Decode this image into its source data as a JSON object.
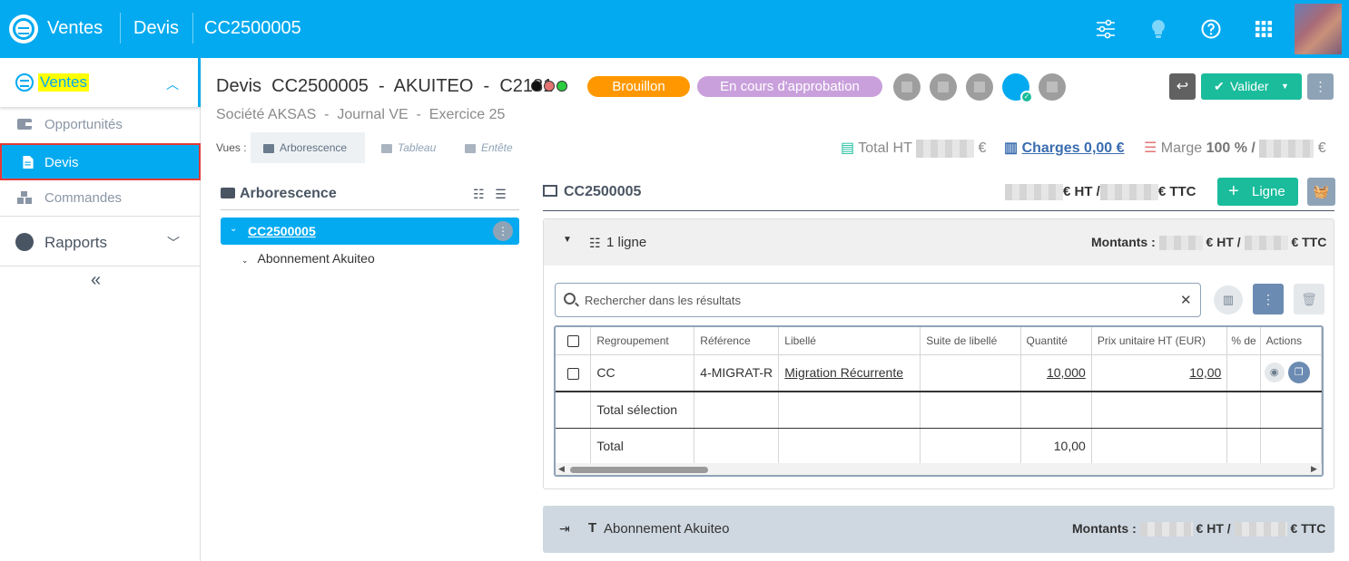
{
  "topbar": {
    "app": "Ventes",
    "section": "Devis",
    "doc": "CC2500005",
    "icons": [
      "sliders-icon",
      "lightbulb-icon",
      "help-icon",
      "apps-grid-icon",
      "avatar"
    ]
  },
  "sidebar": {
    "ventes": "Ventes",
    "items": [
      {
        "label": "Opportunités",
        "icon": "wallet-icon"
      },
      {
        "label": "Devis",
        "icon": "document-icon"
      },
      {
        "label": "Commandes",
        "icon": "boxes-icon"
      }
    ],
    "rapports": "Rapports",
    "collapse": "«"
  },
  "header": {
    "title": "Devis  CC2500005  -  AKUITEO  -  C2181",
    "badge_draft": "Brouillon",
    "badge_approval": "En cours d'approbation",
    "subtitle": "Société AKSAS  -  Journal VE  -  Exercice 25",
    "valider": "Valider",
    "colors": {
      "accent": "#03aaf0",
      "draft": "#ff9800",
      "approval": "#c9a0dc",
      "green": "#1abc9c"
    }
  },
  "views": {
    "label": "Vues :",
    "items": [
      "Arborescence",
      "Tableau",
      "Entête"
    ]
  },
  "totals": {
    "total_ht_label": "Total HT",
    "currency": "€",
    "charges": "Charges 0,00 €",
    "marge_label": "Marge",
    "marge_pct": "100 % /"
  },
  "tree": {
    "title": "Arborescence",
    "root": "CC2500005",
    "child": "Abonnement Akuiteo"
  },
  "right": {
    "title": "CC2500005",
    "ht_suffix": "€ HT /",
    "ttc_suffix": "€ TTC",
    "add_line": "Ligne",
    "panel_label": "1 ligne",
    "montants_label": "Montants :",
    "search_placeholder": "Rechercher dans les résultats",
    "columns": [
      "Regroupement",
      "Référence",
      "Libellé",
      "Suite de libellé",
      "Quantité",
      "Prix unitaire HT (EUR)",
      "% de",
      "Actions"
    ],
    "row": {
      "regroupement": "CC",
      "reference": "4-MIGRAT-R",
      "libelle": "Migration Récurrente",
      "suite": "",
      "quantite": "10,000",
      "prix": "10,00"
    },
    "total_selection": "Total sélection",
    "total": "Total",
    "total_qty": "10,00",
    "panel2_label": "Abonnement Akuiteo"
  }
}
